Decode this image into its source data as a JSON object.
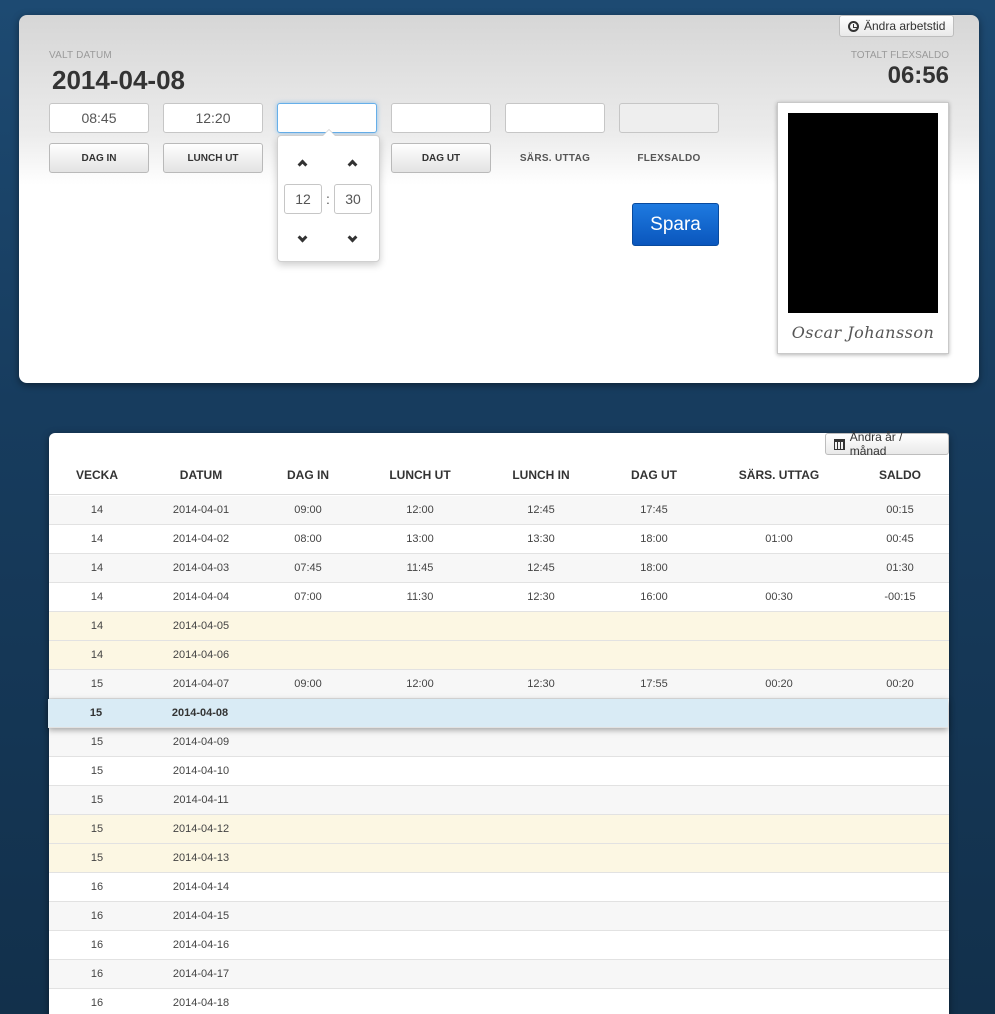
{
  "header": {
    "change_worktime_label": "Ändra arbetstid",
    "selected_date_label": "VALT DATUM",
    "selected_date": "2014-04-08",
    "total_flex_label": "TOTALT FLEXSALDO",
    "total_flex_value": "06:56"
  },
  "time_inputs": {
    "dag_in": "08:45",
    "lunch_ut": "12:20",
    "lunch_in": "",
    "dag_ut": "",
    "sars_uttag": "",
    "flexsaldo": ""
  },
  "buttons": {
    "dag_in": "DAG IN",
    "lunch_ut": "LUNCH UT",
    "dag_ut": "DAG UT",
    "sars_uttag": "SÄRS. UTTAG",
    "flexsaldo": "FLEXSALDO",
    "save": "Spara"
  },
  "timepicker": {
    "hours": "12",
    "minutes": "30",
    "separator": ":"
  },
  "profile": {
    "name": "Oscar Johansson"
  },
  "table": {
    "change_period_label": "Ändra år / månad",
    "columns": [
      "VECKA",
      "DATUM",
      "DAG IN",
      "LUNCH UT",
      "LUNCH IN",
      "DAG UT",
      "SÄRS. UTTAG",
      "SALDO"
    ],
    "rows": [
      [
        "14",
        "2014-04-01",
        "09:00",
        "12:00",
        "12:45",
        "17:45",
        "",
        "00:15"
      ],
      [
        "14",
        "2014-04-02",
        "08:00",
        "13:00",
        "13:30",
        "18:00",
        "01:00",
        "00:45"
      ],
      [
        "14",
        "2014-04-03",
        "07:45",
        "11:45",
        "12:45",
        "18:00",
        "",
        "01:30"
      ],
      [
        "14",
        "2014-04-04",
        "07:00",
        "11:30",
        "12:30",
        "16:00",
        "00:30",
        "-00:15"
      ],
      [
        "14",
        "2014-04-05",
        "",
        "",
        "",
        "",
        "",
        ""
      ],
      [
        "14",
        "2014-04-06",
        "",
        "",
        "",
        "",
        "",
        ""
      ],
      [
        "15",
        "2014-04-07",
        "09:00",
        "12:00",
        "12:30",
        "17:55",
        "00:20",
        "00:20"
      ],
      [
        "15",
        "2014-04-08",
        "",
        "",
        "",
        "",
        "",
        ""
      ],
      [
        "15",
        "2014-04-09",
        "",
        "",
        "",
        "",
        "",
        ""
      ],
      [
        "15",
        "2014-04-10",
        "",
        "",
        "",
        "",
        "",
        ""
      ],
      [
        "15",
        "2014-04-11",
        "",
        "",
        "",
        "",
        "",
        ""
      ],
      [
        "15",
        "2014-04-12",
        "",
        "",
        "",
        "",
        "",
        ""
      ],
      [
        "15",
        "2014-04-13",
        "",
        "",
        "",
        "",
        "",
        ""
      ],
      [
        "16",
        "2014-04-14",
        "",
        "",
        "",
        "",
        "",
        ""
      ],
      [
        "16",
        "2014-04-15",
        "",
        "",
        "",
        "",
        "",
        ""
      ],
      [
        "16",
        "2014-04-16",
        "",
        "",
        "",
        "",
        "",
        ""
      ],
      [
        "16",
        "2014-04-17",
        "",
        "",
        "",
        "",
        "",
        ""
      ],
      [
        "16",
        "2014-04-18",
        "",
        "",
        "",
        "",
        "",
        ""
      ]
    ],
    "weekend_rows": [
      4,
      5,
      11,
      12
    ],
    "selected_row": 7
  }
}
